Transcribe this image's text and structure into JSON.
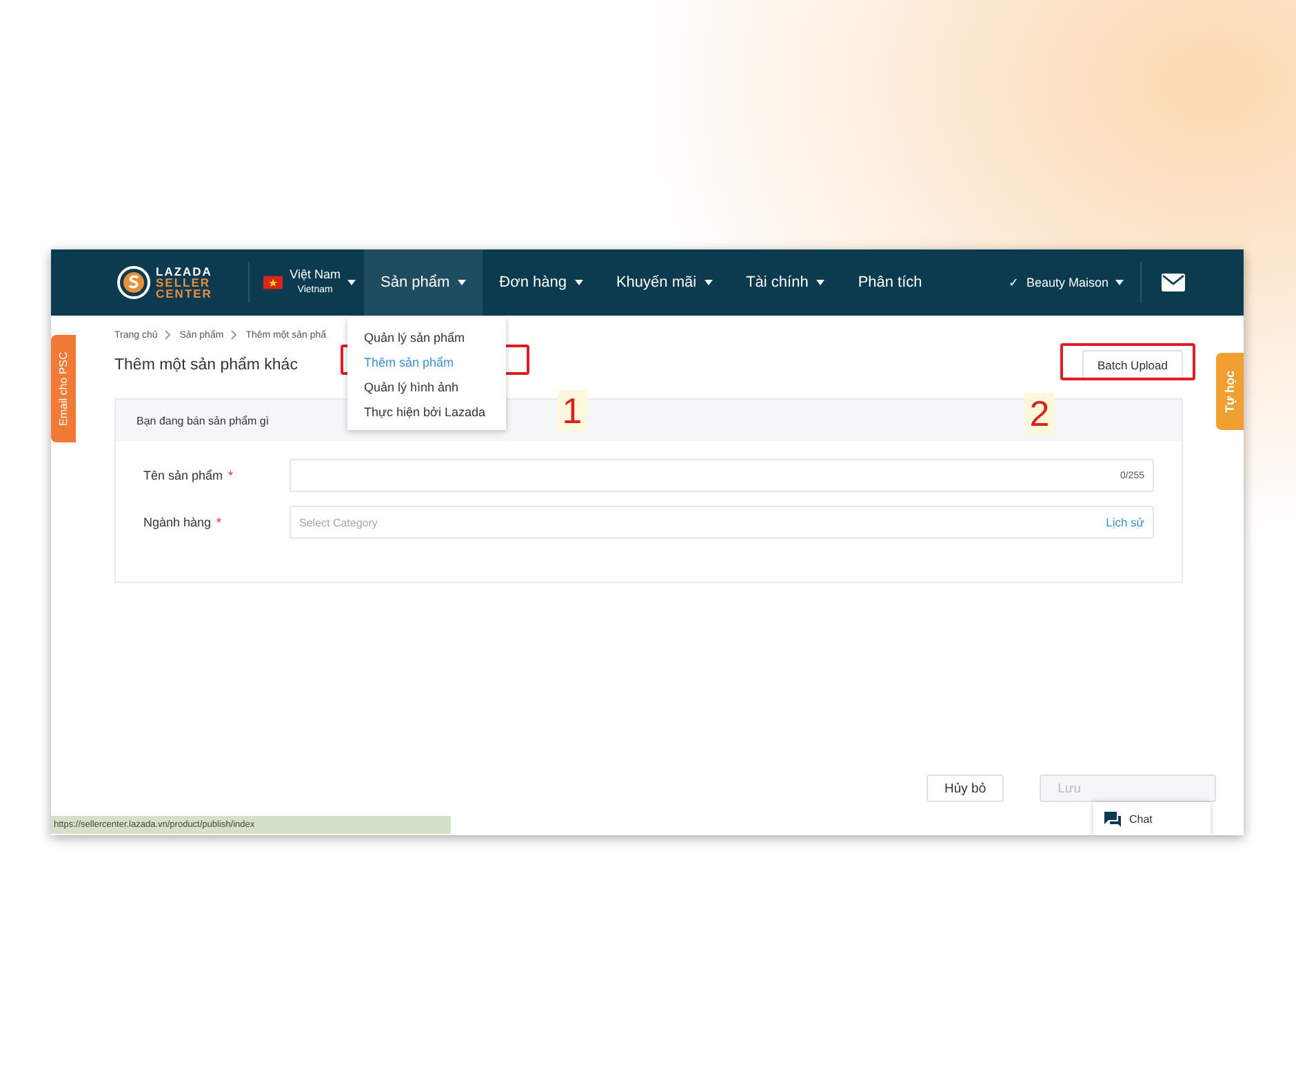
{
  "nav": {
    "logo": [
      "LAZADA",
      "SELLER",
      "CENTER"
    ],
    "country": {
      "name": "Việt Nam",
      "sub": "Vietnam"
    },
    "menus": [
      {
        "label": "Sản phẩm",
        "selected": true,
        "dropdown": true
      },
      {
        "label": "Đơn hàng",
        "selected": false,
        "dropdown": true
      },
      {
        "label": "Khuyến mãi",
        "selected": false,
        "dropdown": true
      },
      {
        "label": "Tài chính",
        "selected": false,
        "dropdown": true
      },
      {
        "label": "Phân tích",
        "selected": false,
        "dropdown": false
      }
    ],
    "account": {
      "check": "✓",
      "name": "Beauty Maison"
    }
  },
  "menu_dropdown": {
    "items": [
      {
        "label": "Quản lý sản phẩm",
        "selected": false
      },
      {
        "label": "Thêm sản phẩm",
        "selected": true
      },
      {
        "label": "Quản lý hình ảnh",
        "selected": false
      },
      {
        "label": "Thực hiện bởi Lazada",
        "selected": false
      }
    ]
  },
  "breadcrumb": [
    "Trang chủ",
    "Sản phẩm",
    "Thêm một sản phẩ"
  ],
  "page_title": "Thêm một sản phẩm khác",
  "batch_button": "Batch Upload",
  "side_tabs": {
    "left": "Email cho PSC",
    "right": "Tự học"
  },
  "form": {
    "header": "Bạn đang bán sản phẩm gì",
    "fields": [
      {
        "kind": "text",
        "label": "Tên sản phẩm",
        "required_mark": "*",
        "counter": "0/255"
      },
      {
        "kind": "select",
        "label": "Ngành hàng",
        "required_mark": "*",
        "placeholder": "Select Category",
        "link": "Lịch sử"
      }
    ]
  },
  "footer": {
    "buttons": [
      {
        "label": "Hủy bỏ",
        "disabled": false
      },
      {
        "label": "Lưu",
        "disabled": true
      }
    ]
  },
  "chat": "Chat",
  "status_url": "https://sellercenter.lazada.vn/product/publish/index",
  "annotations": [
    {
      "number": "1"
    },
    {
      "number": "2"
    }
  ]
}
